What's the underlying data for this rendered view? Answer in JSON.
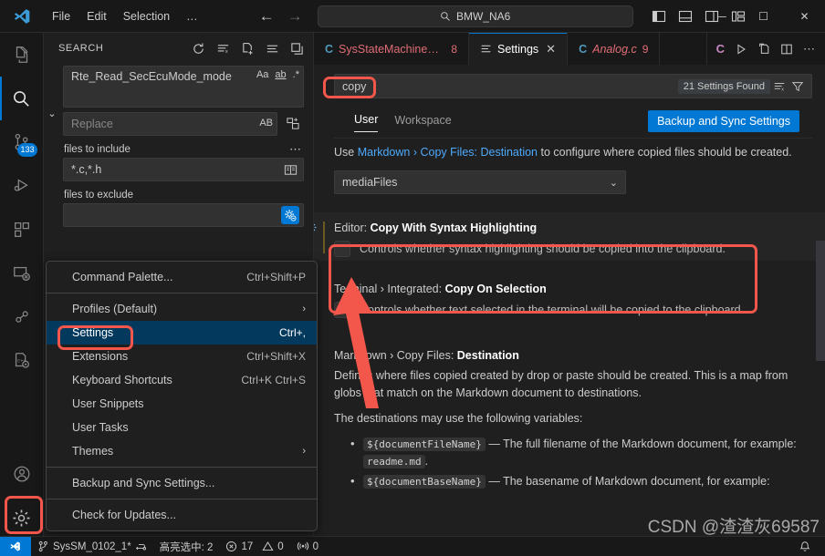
{
  "titlebar": {
    "menus": [
      "File",
      "Edit",
      "Selection",
      "…"
    ],
    "quick_open_value": "BMW_NA6",
    "back_label": "←",
    "forward_label": "→",
    "minimize": "─",
    "maximize": "☐",
    "close": "✕"
  },
  "activitybar": {
    "items": [
      {
        "name": "explorer",
        "icon": "files-icon"
      },
      {
        "name": "search",
        "icon": "search-icon",
        "active": true
      },
      {
        "name": "source-control",
        "icon": "source-control-icon",
        "badge": "133"
      },
      {
        "name": "run-debug",
        "icon": "run-and-debug-icon"
      },
      {
        "name": "extensions",
        "icon": "extensions-icon"
      },
      {
        "name": "remote-explorer",
        "icon": "remote-explorer-icon"
      },
      {
        "name": "testing",
        "icon": "beaker-icon"
      },
      {
        "name": "cpp-config",
        "icon": "cpp-config-icon"
      }
    ],
    "bottom": [
      {
        "name": "accounts",
        "icon": "account-icon"
      },
      {
        "name": "manage",
        "icon": "gear-icon"
      }
    ]
  },
  "sidebar": {
    "title": "SEARCH",
    "actions": [
      "refresh-icon",
      "clear-search-results-icon",
      "open-new-search-editor-icon",
      "view-as-list-icon",
      "collapse-all-icon"
    ],
    "search_value": "Rte_Read_SecEcuMode_mode",
    "search_toggles": [
      "Aa",
      "ab",
      ".*"
    ],
    "replace_placeholder": "Replace",
    "replace_toggle": "AB",
    "replace_all_icon": "replace-all-icon",
    "include_label": "files to include",
    "include_value": "*.c,*.h",
    "include_icon": "book-icon",
    "exclude_label": "files to exclude",
    "exclude_value": "",
    "exclude_icon": "settings-gear-exclude-icon",
    "more_icon": "⋯"
  },
  "context_menu": {
    "items": [
      {
        "label": "Command Palette...",
        "key": "Ctrl+Shift+P",
        "type": "item"
      },
      {
        "type": "separator"
      },
      {
        "label": "Profiles (Default)",
        "key": "",
        "type": "submenu"
      },
      {
        "label": "Settings",
        "key": "Ctrl+,",
        "type": "item",
        "selected": true
      },
      {
        "label": "Extensions",
        "key": "Ctrl+Shift+X",
        "type": "item"
      },
      {
        "label": "Keyboard Shortcuts",
        "key": "Ctrl+K Ctrl+S",
        "type": "item"
      },
      {
        "label": "User Snippets",
        "key": "",
        "type": "item"
      },
      {
        "label": "User Tasks",
        "key": "",
        "type": "item"
      },
      {
        "label": "Themes",
        "key": "",
        "type": "submenu"
      },
      {
        "type": "separator"
      },
      {
        "label": "Backup and Sync Settings...",
        "key": "",
        "type": "item"
      },
      {
        "type": "separator"
      },
      {
        "label": "Check for Updates...",
        "key": "",
        "type": "item"
      }
    ]
  },
  "tabs": [
    {
      "name": "SysStateMachineM.c",
      "badge": "8",
      "icon": "c-file-icon",
      "active": false,
      "error": true,
      "italic": false
    },
    {
      "name": "Settings",
      "badge": "",
      "icon": "settings-list-icon",
      "active": true,
      "error": false,
      "italic": false,
      "close": "✕"
    },
    {
      "name": "Analog.c",
      "badge": "9",
      "icon": "c-file-icon",
      "active": false,
      "error": true,
      "italic": true
    }
  ],
  "tabs_right_icons": [
    "c-run-icon",
    "run-icon",
    "split-terminal-icon",
    "split-editor-icon",
    "more-actions-icon"
  ],
  "settings": {
    "search_value": "copy",
    "results_count": "21 Settings Found",
    "clear_icon": "clear-settings-search-icon",
    "filter_icon": "filter-icon",
    "tabs": [
      {
        "label": "User",
        "active": true
      },
      {
        "label": "Workspace",
        "active": false
      }
    ],
    "sync_button": "Backup and Sync Settings",
    "rows": [
      {
        "type": "description",
        "prefix": "Use ",
        "link": "Markdown › Copy Files: Destination",
        "suffix": " to configure where copied files should be created.",
        "dropdown_value": "mediaFiles"
      },
      {
        "type": "checkbox-setting",
        "category": "Editor: ",
        "title": "Copy With Syntax Highlighting",
        "description": "Controls whether syntax highlighting should be copied into the clipboard.",
        "checked": false,
        "highlighted": true
      },
      {
        "type": "checkbox-setting",
        "category": "Terminal › Integrated: ",
        "title": "Copy On Selection",
        "description": "Controls whether text selected in the terminal will be copied to the clipboard.",
        "checked": false,
        "highlighted": false
      }
    ],
    "markdown_block": {
      "category": "Markdown › Copy Files: ",
      "title": "Destination",
      "paragraph1": "Defines where files copied created by drop or paste should be created. This is a map from globs that match on the Markdown document to destinations.",
      "paragraph2": "The destinations may use the following variables:",
      "bullets": [
        {
          "code": "${documentFileName}",
          "text": " — The full filename of the Markdown document, for example: ",
          "code2": "readme.md",
          "tail": "."
        },
        {
          "code": "${documentBaseName}",
          "text": " — The basename of Markdown document, for example: ",
          "code2": "",
          "tail": ""
        }
      ]
    }
  },
  "statusbar": {
    "remote_icon": "remote-window-icon",
    "branch": "SysSM_0102_1*",
    "branch_icon": "source-control-branch-icon",
    "sync_icon": "sync-icon",
    "selection": "高亮选中: 2",
    "errors_icon": "error-icon",
    "errors": "17",
    "warnings_icon": "warning-icon",
    "warnings": "0",
    "ports_icon": "radio-tower-icon",
    "ports": "0",
    "bell_icon": "bell-icon"
  },
  "watermark": "CSDN @渣渣灰69587",
  "colors": {
    "accent": "#0078d4",
    "annotation": "#f3564a",
    "selection": "#04395e",
    "link": "#4daafc",
    "error": "#e06c75"
  }
}
